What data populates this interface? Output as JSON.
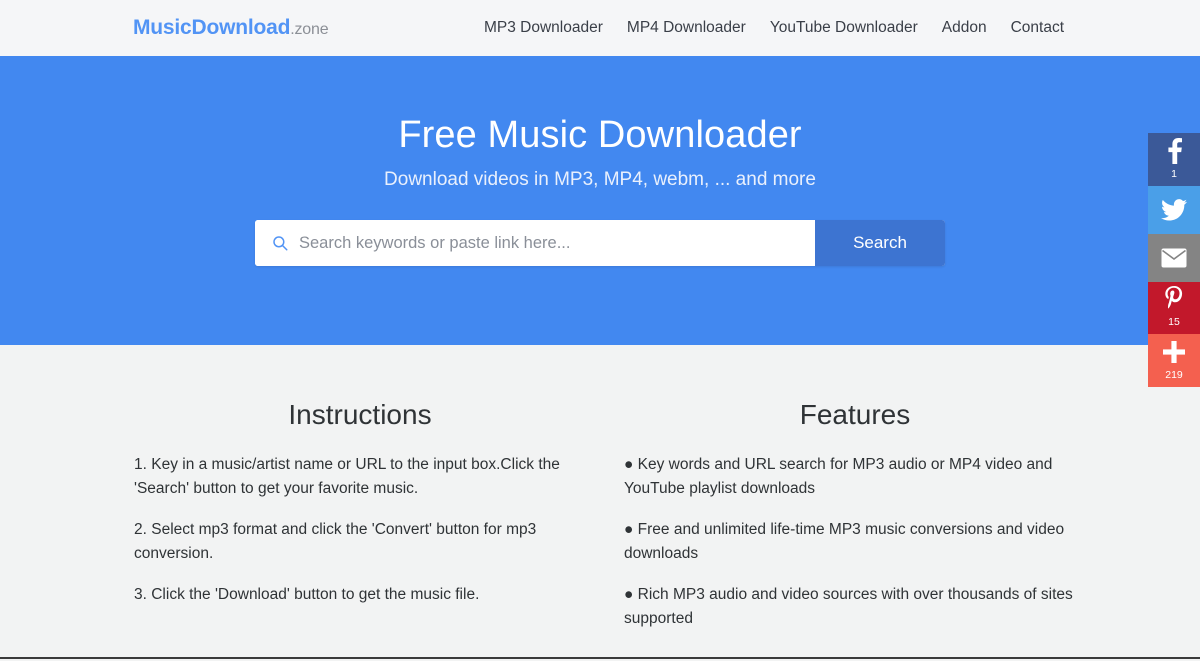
{
  "header": {
    "logo": {
      "brand": "MusicDownload",
      "tld": ".zone"
    },
    "nav": [
      {
        "label": "MP3 Downloader"
      },
      {
        "label": "MP4 Downloader"
      },
      {
        "label": "YouTube Downloader"
      },
      {
        "label": "Addon"
      },
      {
        "label": "Contact"
      }
    ]
  },
  "hero": {
    "title": "Free Music Downloader",
    "subtitle": "Download videos in MP3, MP4, webm, ... and more",
    "background_color": "#4288f0",
    "search": {
      "placeholder": "Search keywords or paste link here...",
      "value": "",
      "button_label": "Search",
      "button_color": "#3d74d1",
      "icon": "search-icon"
    }
  },
  "social_share": [
    {
      "network": "facebook",
      "icon": "facebook-icon",
      "count": "1",
      "color": "#3b5998"
    },
    {
      "network": "twitter",
      "icon": "twitter-icon",
      "count": "",
      "color": "#4a9fe8"
    },
    {
      "network": "email",
      "icon": "email-icon",
      "count": "",
      "color": "#848484"
    },
    {
      "network": "pinterest",
      "icon": "pinterest-icon",
      "count": "15",
      "color": "#c2182b"
    },
    {
      "network": "addthis",
      "icon": "plus-icon",
      "count": "219",
      "color": "#f4604f"
    }
  ],
  "content": {
    "instructions": {
      "title": "Instructions",
      "items": [
        "1. Key in a music/artist name or URL to the input box.Click the 'Search' button to get your favorite music.",
        "2. Select mp3 format and click the 'Convert' button for mp3 conversion.",
        "3. Click the 'Download' button to get the music file."
      ]
    },
    "features": {
      "title": "Features",
      "items": [
        "● Key words and URL search for MP3 audio or MP4 video and YouTube playlist downloads",
        "● Free and unlimited life-time MP3 music conversions and video downloads",
        "● Rich MP3 audio and video sources with over thousands of sites supported"
      ]
    }
  }
}
